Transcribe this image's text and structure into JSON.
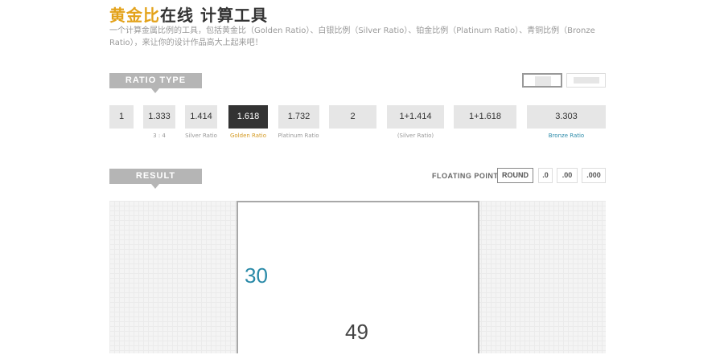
{
  "header": {
    "title_highlight": "黄金比",
    "title_rest": "在线 计算工具",
    "description": "一个计算金属比例的工具，包括黄金比（Golden Ratio）、白银比例（Silver Ratio）、铂金比例（Platinum Ratio）、青铜比例（Bronze Ratio），来让你的设计作品高大上起来吧！"
  },
  "ratio_section": {
    "label": "RATIO TYPE",
    "buttons": [
      {
        "label": "1",
        "sub": ""
      },
      {
        "label": "1.333",
        "sub": "3 : 4"
      },
      {
        "label": "1.414",
        "sub": "Silver Ratio"
      },
      {
        "label": "1.618",
        "sub": "Golden Ratio",
        "active": true
      },
      {
        "label": "1.732",
        "sub": "Platinum Ratio"
      },
      {
        "label": "2",
        "sub": ""
      },
      {
        "label": "1+1.414",
        "sub": "(Silver Ratio)"
      },
      {
        "label": "1+1.618",
        "sub": ""
      },
      {
        "label": "3.303",
        "sub": "Bronze Ratio"
      }
    ]
  },
  "result_section": {
    "label": "RESULT",
    "floating_label": "FLOATING POINT",
    "floating_options": [
      "ROUND",
      ".0",
      ".00",
      ".000"
    ],
    "floating_selected": "ROUND",
    "height_value": "30",
    "width_value": "49"
  },
  "colors": {
    "accent_gold": "#e3a21a",
    "accent_blue": "#2a8aa8",
    "active_button": "#333333",
    "tag_gray": "#b5b5b5"
  }
}
